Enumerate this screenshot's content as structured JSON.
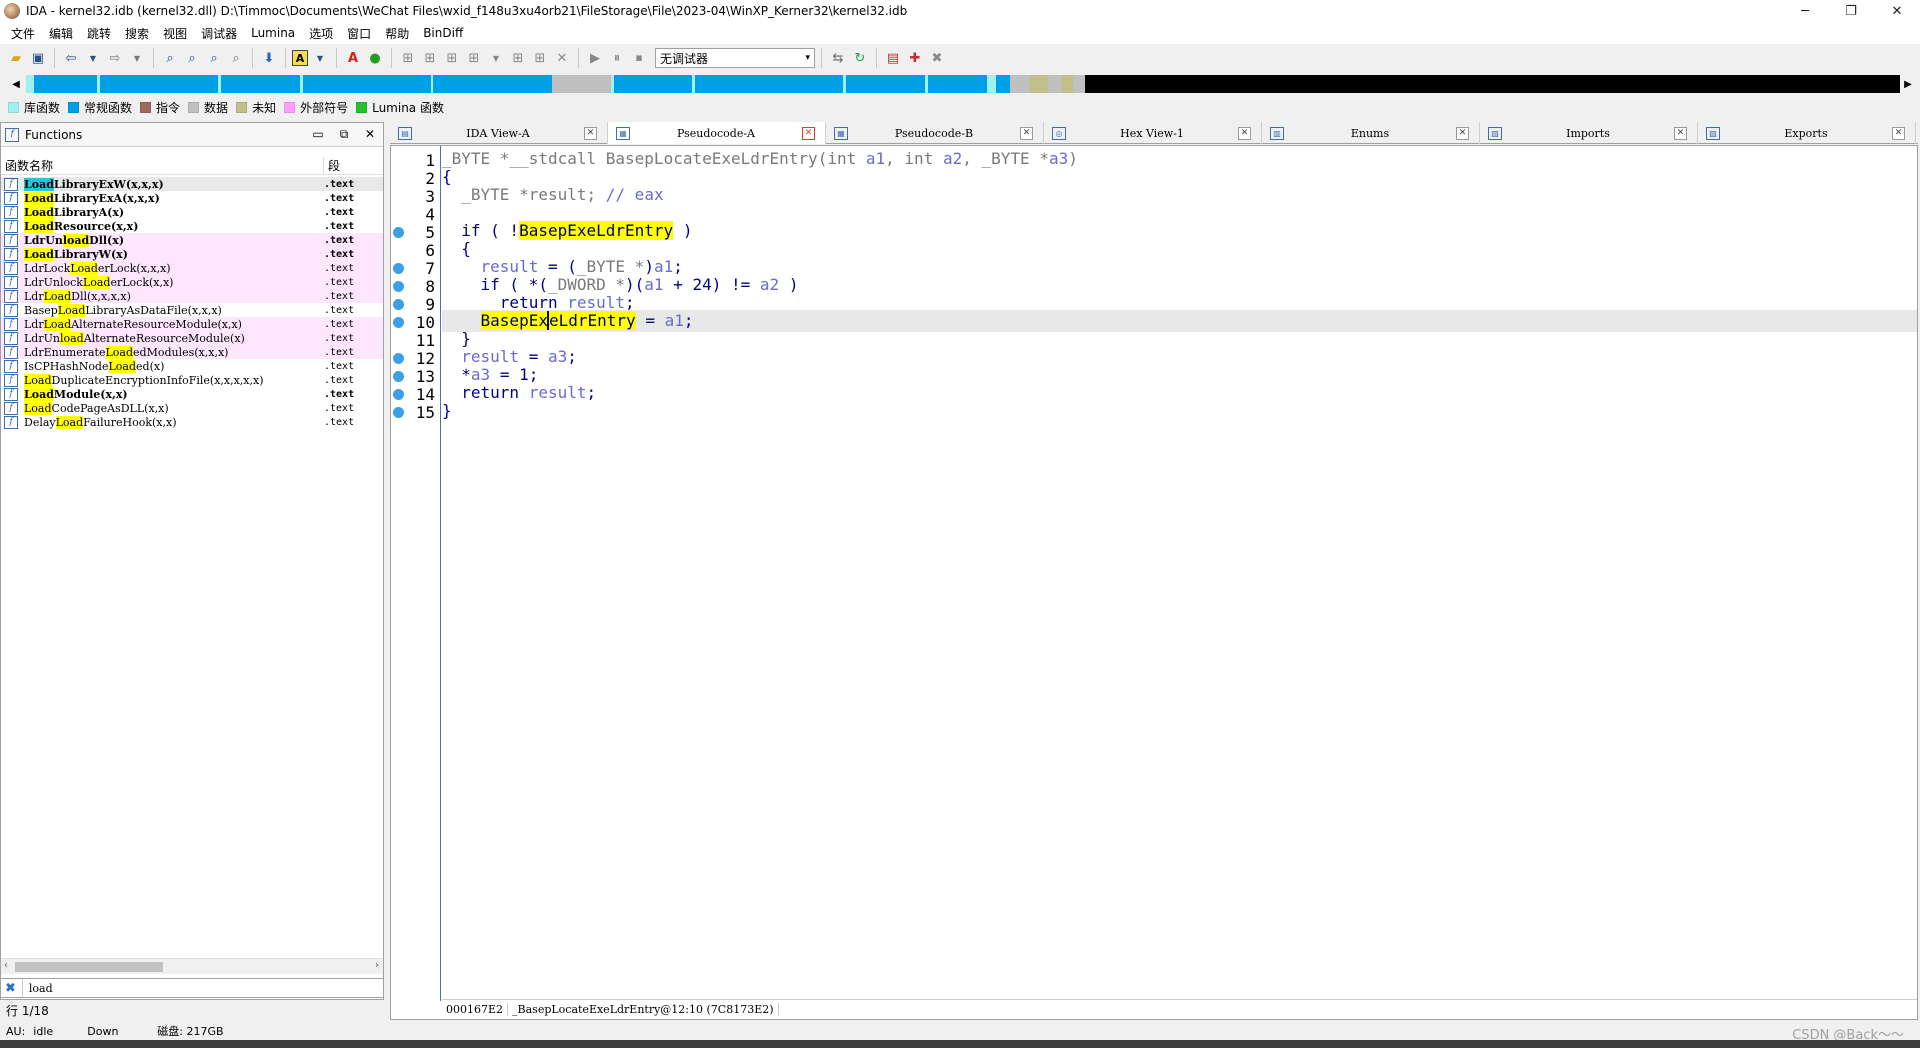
{
  "window": {
    "title": "IDA - kernel32.idb (kernel32.dll) D:\\Timmoc\\Documents\\WeChat Files\\wxid_f148u3xu4orb21\\FileStorage\\File\\2023-04\\WinXP_Kerner32\\kernel32.idb",
    "minimize": "─",
    "maximize": "❐",
    "close": "✕"
  },
  "menu": [
    "文件",
    "编辑",
    "跳转",
    "搜索",
    "视图",
    "调试器",
    "Lumina",
    "选项",
    "窗口",
    "帮助",
    "BinDiff"
  ],
  "toolbar": {
    "debugger_select": "无调试器"
  },
  "legend": [
    {
      "label": "库函数",
      "color": "#9ff2f2"
    },
    {
      "label": "常规函数",
      "color": "#00a0e6"
    },
    {
      "label": "指令",
      "color": "#a0695a"
    },
    {
      "label": "数据",
      "color": "#c0c0c0"
    },
    {
      "label": "未知",
      "color": "#c0c08a"
    },
    {
      "label": "外部符号",
      "color": "#ff9fff"
    },
    {
      "label": "Lumina 函数",
      "color": "#27c030"
    }
  ],
  "functions_panel": {
    "title": "Functions",
    "col_name": "函数名称",
    "col_segment": "段",
    "rows": [
      {
        "pre": "",
        "hl": "Load",
        "post": "LibraryExW(x,x,x)",
        "seg": ".text",
        "bold": true,
        "pink": false,
        "sel": true,
        "cyan": true
      },
      {
        "pre": "",
        "hl": "Load",
        "post": "LibraryExA(x,x,x)",
        "seg": ".text",
        "bold": true,
        "pink": false
      },
      {
        "pre": "",
        "hl": "Load",
        "post": "LibraryA(x)",
        "seg": ".text",
        "bold": true,
        "pink": false
      },
      {
        "pre": "",
        "hl": "Load",
        "post": "Resource(x,x)",
        "seg": ".text",
        "bold": true,
        "pink": false
      },
      {
        "pre": "LdrUn",
        "hl": "load",
        "post": "Dll(x)",
        "seg": ".text",
        "bold": true,
        "pink": true
      },
      {
        "pre": "",
        "hl": "Load",
        "post": "LibraryW(x)",
        "seg": ".text",
        "bold": true,
        "pink": true
      },
      {
        "pre": "LdrLock",
        "hl": "Load",
        "post": "erLock(x,x,x)",
        "seg": ".text",
        "bold": false,
        "pink": true
      },
      {
        "pre": "LdrUnlock",
        "hl": "Load",
        "post": "erLock(x,x)",
        "seg": ".text",
        "bold": false,
        "pink": true
      },
      {
        "pre": "Ldr",
        "hl": "Load",
        "post": "Dll(x,x,x,x)",
        "seg": ".text",
        "bold": false,
        "pink": true
      },
      {
        "pre": "Basep",
        "hl": "Load",
        "post": "LibraryAsDataFile(x,x,x)",
        "seg": ".text",
        "bold": false,
        "pink": false
      },
      {
        "pre": "Ldr",
        "hl": "Load",
        "post": "AlternateResourceModule(x,x)",
        "seg": ".text",
        "bold": false,
        "pink": true
      },
      {
        "pre": "LdrUn",
        "hl": "load",
        "post": "AlternateResourceModule(x)",
        "seg": ".text",
        "bold": false,
        "pink": true
      },
      {
        "pre": "LdrEnumerate",
        "hl": "Load",
        "post": "edModules(x,x,x)",
        "seg": ".text",
        "bold": false,
        "pink": true
      },
      {
        "pre": "IsCPHashNode",
        "hl": "Load",
        "post": "ed(x)",
        "seg": ".text",
        "bold": false,
        "pink": false
      },
      {
        "pre": "",
        "hl": "Load",
        "post": "DuplicateEncryptionInfoFile(x,x,x,x,x)",
        "seg": ".text",
        "bold": false,
        "pink": false
      },
      {
        "pre": "",
        "hl": "Load",
        "post": "Module(x,x)",
        "seg": ".text",
        "bold": true,
        "pink": false
      },
      {
        "pre": "",
        "hl": "Load",
        "post": "CodePageAsDLL(x,x)",
        "seg": ".text",
        "bold": false,
        "pink": false
      },
      {
        "pre": "Delay",
        "hl": "Load",
        "post": "FailureHook(x,x)",
        "seg": ".text",
        "bold": false,
        "pink": false
      }
    ],
    "filter_value": "load",
    "row_count": "行 1/18"
  },
  "tabs": [
    {
      "label": "IDA View-A",
      "active": false,
      "icon": "ida-view-icon"
    },
    {
      "label": "Pseudocode-A",
      "active": true,
      "icon": "pseudocode-icon"
    },
    {
      "label": "Pseudocode-B",
      "active": false,
      "icon": "pseudocode-icon"
    },
    {
      "label": "Hex View-1",
      "active": false,
      "icon": "hex-icon"
    },
    {
      "label": "Enums",
      "active": false,
      "icon": "enums-icon"
    },
    {
      "label": "Imports",
      "active": false,
      "icon": "imports-icon"
    },
    {
      "label": "Exports",
      "active": false,
      "icon": "exports-icon"
    }
  ],
  "code": {
    "current_line": 10,
    "lines": [
      {
        "n": "1",
        "bp": false,
        "html": "<span class='tk-g'>_BYTE *__stdcall</span> <span class='tk-g'>BasepLocateExeLdrEntry</span><span class='tk-g'>(</span><span class='tk-g'>int</span> <span class='tk-v'>a1</span><span class='tk-g'>,</span> <span class='tk-g'>int</span> <span class='tk-v'>a2</span><span class='tk-g'>,</span> <span class='tk-g'>_BYTE *</span><span class='tk-v'>a3</span><span class='tk-g'>)</span>"
      },
      {
        "n": "2",
        "bp": false,
        "html": "<span class='tk-t'>{</span>"
      },
      {
        "n": "3",
        "bp": false,
        "html": "  <span class='tk-g'>_BYTE *</span><span class='tk-g'>result</span><span class='tk-g'>;</span> <span class='tk-v'>// eax</span>"
      },
      {
        "n": "4",
        "bp": false,
        "html": ""
      },
      {
        "n": "5",
        "bp": true,
        "html": "  <span class='tk-t'>if ( !</span><span class='hl tk-t'>BasepExeLdrEntry</span><span class='tk-t'> )</span>"
      },
      {
        "n": "6",
        "bp": false,
        "html": "  <span class='tk-t'>{</span>"
      },
      {
        "n": "7",
        "bp": true,
        "html": "    <span class='tk-v'>result</span> <span class='tk-t'>= (</span><span class='tk-g'>_BYTE *</span><span class='tk-t'>)</span><span class='tk-v'>a1</span><span class='tk-t'>;</span>"
      },
      {
        "n": "8",
        "bp": true,
        "html": "    <span class='tk-t'>if ( *(</span><span class='tk-g'>_DWORD *</span><span class='tk-t'>)(</span><span class='tk-v'>a1</span> <span class='tk-t'>+ 24) != </span><span class='tk-v'>a2</span> <span class='tk-t'>)</span>"
      },
      {
        "n": "9",
        "bp": true,
        "html": "      <span class='tk-t'>return</span> <span class='tk-v'>result</span><span class='tk-t'>;</span>"
      },
      {
        "n": "10",
        "bp": true,
        "html": "    <span class='hl tk-t'>BasepEx<span class='caret'></span>eLdrEntry</span> <span class='tk-t'>=</span> <span class='tk-v'>a1</span><span class='tk-t'>;</span>"
      },
      {
        "n": "11",
        "bp": false,
        "html": "  <span class='tk-t'>}</span>"
      },
      {
        "n": "12",
        "bp": true,
        "html": "  <span class='tk-v'>result</span> <span class='tk-t'>=</span> <span class='tk-v'>a3</span><span class='tk-t'>;</span>"
      },
      {
        "n": "13",
        "bp": true,
        "html": "  <span class='tk-t'>*</span><span class='tk-v'>a3</span> <span class='tk-t'>= 1;</span>"
      },
      {
        "n": "14",
        "bp": true,
        "html": "  <span class='tk-t'>return</span> <span class='tk-v'>result</span><span class='tk-t'>;</span>"
      },
      {
        "n": "15",
        "bp": true,
        "html": "<span class='tk-t'>}</span>"
      }
    ],
    "status": [
      "000167E2",
      "_BasepLocateExeLdrEntry@12:10 (7C8173E2)"
    ]
  },
  "bottom": {
    "au_label": "AU:",
    "au_state": "idle",
    "direction": "Down",
    "disk": "磁盘: 217GB"
  },
  "watermark": "CSDN @Back～～"
}
